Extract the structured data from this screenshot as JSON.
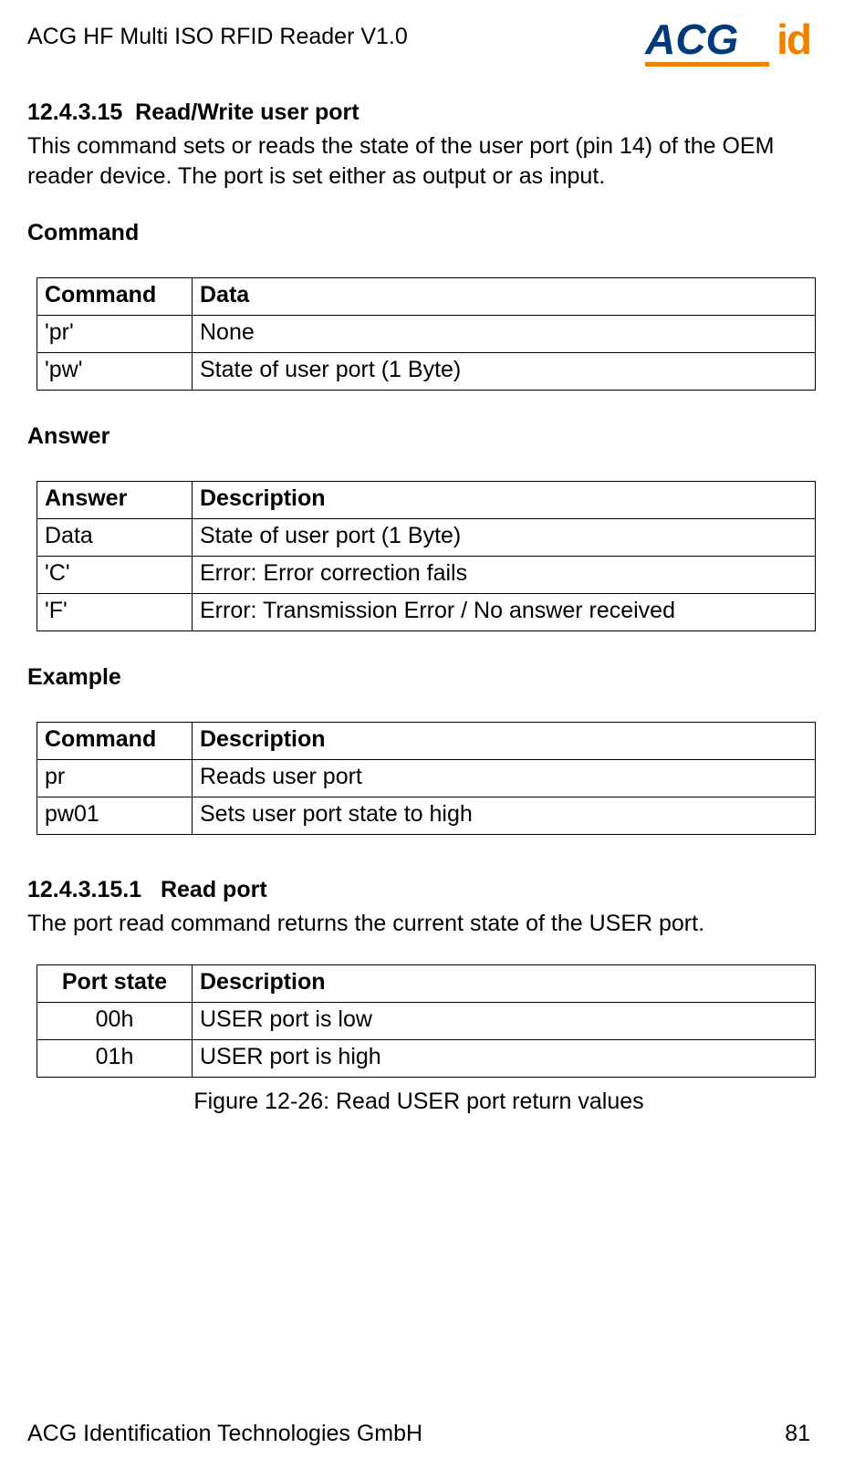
{
  "header": {
    "doc_title": "ACG HF Multi ISO RFID Reader V1.0",
    "logo_text_1": "ACG",
    "logo_text_2": "id"
  },
  "s1": {
    "num": "12.4.3.15",
    "title": "Read/Write user port",
    "para": "This command sets or reads the state of the user port (pin 14) of the OEM reader device. The port is set either as output or as input."
  },
  "cmd": {
    "heading": "Command",
    "th1": "Command",
    "th2": "Data",
    "rows": [
      {
        "c1": "'pr'",
        "c2": "None"
      },
      {
        "c1": "'pw'",
        "c2": "State of user port (1 Byte)"
      }
    ]
  },
  "ans": {
    "heading": "Answer",
    "th1": "Answer",
    "th2": "Description",
    "rows": [
      {
        "c1": "Data",
        "c2": "State of user port (1 Byte)"
      },
      {
        "c1": "'C'",
        "c2": "Error: Error correction fails"
      },
      {
        "c1": "'F'",
        "c2": "Error: Transmission Error / No answer received"
      }
    ]
  },
  "ex": {
    "heading": "Example",
    "th1": "Command",
    "th2": "Description",
    "rows": [
      {
        "c1": "pr",
        "c2": "Reads user port"
      },
      {
        "c1": "pw01",
        "c2": "Sets user port state to high"
      }
    ]
  },
  "s2": {
    "num": "12.4.3.15.1",
    "title": "Read port",
    "para": "The port read command returns the current state of the USER port."
  },
  "port": {
    "th1": "Port state",
    "th2": "Description",
    "rows": [
      {
        "c1": "00h",
        "c2": "USER port is low"
      },
      {
        "c1": "01h",
        "c2": "USER port is high"
      }
    ],
    "caption": "Figure 12-26: Read USER port return values"
  },
  "footer": {
    "left": "ACG Identification Technologies GmbH",
    "right": "81"
  }
}
